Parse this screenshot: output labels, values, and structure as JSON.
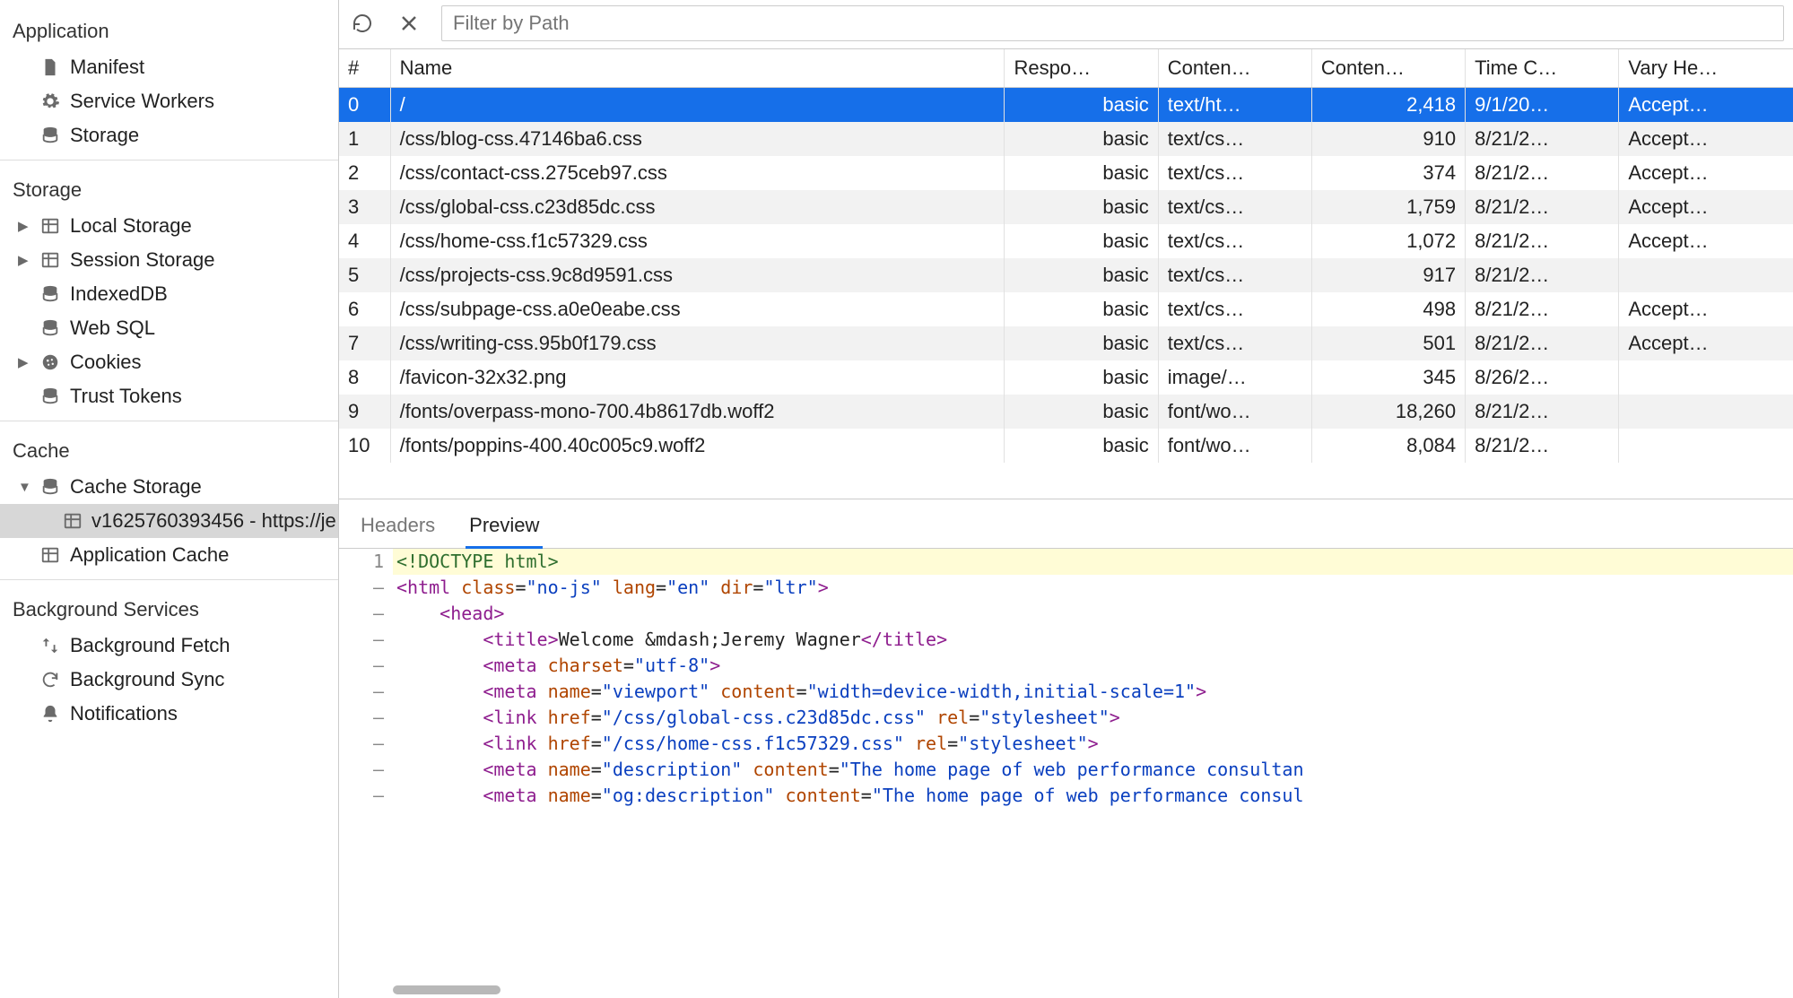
{
  "sidebar": {
    "sections": [
      {
        "title": "Application",
        "items": [
          {
            "name": "manifest",
            "label": "Manifest",
            "icon": "file-icon"
          },
          {
            "name": "service-workers",
            "label": "Service Workers",
            "icon": "gear-icon"
          },
          {
            "name": "storage",
            "label": "Storage",
            "icon": "database-icon"
          }
        ]
      },
      {
        "title": "Storage",
        "items": [
          {
            "name": "local-storage",
            "label": "Local Storage",
            "icon": "grid-icon",
            "expandable": true
          },
          {
            "name": "session-storage",
            "label": "Session Storage",
            "icon": "grid-icon",
            "expandable": true
          },
          {
            "name": "indexeddb",
            "label": "IndexedDB",
            "icon": "database-icon"
          },
          {
            "name": "web-sql",
            "label": "Web SQL",
            "icon": "database-icon"
          },
          {
            "name": "cookies",
            "label": "Cookies",
            "icon": "cookie-icon",
            "expandable": true
          },
          {
            "name": "trust-tokens",
            "label": "Trust Tokens",
            "icon": "database-icon"
          }
        ]
      },
      {
        "title": "Cache",
        "items": [
          {
            "name": "cache-storage",
            "label": "Cache Storage",
            "icon": "database-icon",
            "expandable": true,
            "expanded": true,
            "children": [
              {
                "name": "cache-entry",
                "label": "v1625760393456 - https://je",
                "icon": "grid-icon",
                "selected": true
              }
            ]
          },
          {
            "name": "application-cache",
            "label": "Application Cache",
            "icon": "grid-icon"
          }
        ]
      },
      {
        "title": "Background Services",
        "items": [
          {
            "name": "bg-fetch",
            "label": "Background Fetch",
            "icon": "swap-icon"
          },
          {
            "name": "bg-sync",
            "label": "Background Sync",
            "icon": "sync-icon"
          },
          {
            "name": "notifications",
            "label": "Notifications",
            "icon": "bell-icon"
          }
        ]
      }
    ]
  },
  "toolbar": {
    "filter_placeholder": "Filter by Path"
  },
  "table": {
    "headers": [
      "#",
      "Name",
      "Respo…",
      "Conten…",
      "Conten…",
      "Time C…",
      "Vary He…"
    ],
    "rows": [
      {
        "idx": "0",
        "name": "/",
        "resp": "basic",
        "ctype": "text/ht…",
        "clen": "2,418",
        "time": "9/1/20…",
        "vary": "Accept…",
        "selected": true
      },
      {
        "idx": "1",
        "name": "/css/blog-css.47146ba6.css",
        "resp": "basic",
        "ctype": "text/cs…",
        "clen": "910",
        "time": "8/21/2…",
        "vary": "Accept…"
      },
      {
        "idx": "2",
        "name": "/css/contact-css.275ceb97.css",
        "resp": "basic",
        "ctype": "text/cs…",
        "clen": "374",
        "time": "8/21/2…",
        "vary": "Accept…"
      },
      {
        "idx": "3",
        "name": "/css/global-css.c23d85dc.css",
        "resp": "basic",
        "ctype": "text/cs…",
        "clen": "1,759",
        "time": "8/21/2…",
        "vary": "Accept…"
      },
      {
        "idx": "4",
        "name": "/css/home-css.f1c57329.css",
        "resp": "basic",
        "ctype": "text/cs…",
        "clen": "1,072",
        "time": "8/21/2…",
        "vary": "Accept…"
      },
      {
        "idx": "5",
        "name": "/css/projects-css.9c8d9591.css",
        "resp": "basic",
        "ctype": "text/cs…",
        "clen": "917",
        "time": "8/21/2…",
        "vary": ""
      },
      {
        "idx": "6",
        "name": "/css/subpage-css.a0e0eabe.css",
        "resp": "basic",
        "ctype": "text/cs…",
        "clen": "498",
        "time": "8/21/2…",
        "vary": "Accept…"
      },
      {
        "idx": "7",
        "name": "/css/writing-css.95b0f179.css",
        "resp": "basic",
        "ctype": "text/cs…",
        "clen": "501",
        "time": "8/21/2…",
        "vary": "Accept…"
      },
      {
        "idx": "8",
        "name": "/favicon-32x32.png",
        "resp": "basic",
        "ctype": "image/…",
        "clen": "345",
        "time": "8/26/2…",
        "vary": ""
      },
      {
        "idx": "9",
        "name": "/fonts/overpass-mono-700.4b8617db.woff2",
        "resp": "basic",
        "ctype": "font/wo…",
        "clen": "18,260",
        "time": "8/21/2…",
        "vary": ""
      },
      {
        "idx": "10",
        "name": "/fonts/poppins-400.40c005c9.woff2",
        "resp": "basic",
        "ctype": "font/wo…",
        "clen": "8,084",
        "time": "8/21/2…",
        "vary": ""
      }
    ]
  },
  "tabs": {
    "headers_label": "Headers",
    "preview_label": "Preview"
  },
  "code": {
    "lines": [
      {
        "n": "1",
        "highlight": true,
        "tokens": [
          {
            "t": "<!DOCTYPE html>",
            "c": "doctype"
          }
        ]
      },
      {
        "n": "–",
        "tokens": [
          {
            "t": "<html ",
            "c": "tag"
          },
          {
            "t": "class",
            "c": "attr"
          },
          {
            "t": "=",
            "c": "text"
          },
          {
            "t": "\"no-js\"",
            "c": "str"
          },
          {
            "t": " ",
            "c": "text"
          },
          {
            "t": "lang",
            "c": "attr"
          },
          {
            "t": "=",
            "c": "text"
          },
          {
            "t": "\"en\"",
            "c": "str"
          },
          {
            "t": " ",
            "c": "text"
          },
          {
            "t": "dir",
            "c": "attr"
          },
          {
            "t": "=",
            "c": "text"
          },
          {
            "t": "\"ltr\"",
            "c": "str"
          },
          {
            "t": ">",
            "c": "tag"
          }
        ]
      },
      {
        "n": "–",
        "indent": 1,
        "tokens": [
          {
            "t": "<head>",
            "c": "tag"
          }
        ]
      },
      {
        "n": "–",
        "indent": 2,
        "tokens": [
          {
            "t": "<title>",
            "c": "tag"
          },
          {
            "t": "Welcome &mdash;Jeremy Wagner",
            "c": "text"
          },
          {
            "t": "</title>",
            "c": "tag"
          }
        ]
      },
      {
        "n": "–",
        "indent": 2,
        "tokens": [
          {
            "t": "<meta ",
            "c": "tag"
          },
          {
            "t": "charset",
            "c": "attr"
          },
          {
            "t": "=",
            "c": "text"
          },
          {
            "t": "\"utf-8\"",
            "c": "str"
          },
          {
            "t": ">",
            "c": "tag"
          }
        ]
      },
      {
        "n": "–",
        "indent": 2,
        "tokens": [
          {
            "t": "<meta ",
            "c": "tag"
          },
          {
            "t": "name",
            "c": "attr"
          },
          {
            "t": "=",
            "c": "text"
          },
          {
            "t": "\"viewport\"",
            "c": "str"
          },
          {
            "t": " ",
            "c": "text"
          },
          {
            "t": "content",
            "c": "attr"
          },
          {
            "t": "=",
            "c": "text"
          },
          {
            "t": "\"width=device-width,initial-scale=1\"",
            "c": "str"
          },
          {
            "t": ">",
            "c": "tag"
          }
        ]
      },
      {
        "n": "–",
        "indent": 2,
        "tokens": [
          {
            "t": "<link ",
            "c": "tag"
          },
          {
            "t": "href",
            "c": "attr"
          },
          {
            "t": "=",
            "c": "text"
          },
          {
            "t": "\"/css/global-css.c23d85dc.css\"",
            "c": "str"
          },
          {
            "t": " ",
            "c": "text"
          },
          {
            "t": "rel",
            "c": "attr"
          },
          {
            "t": "=",
            "c": "text"
          },
          {
            "t": "\"stylesheet\"",
            "c": "str"
          },
          {
            "t": ">",
            "c": "tag"
          }
        ]
      },
      {
        "n": "–",
        "indent": 2,
        "tokens": [
          {
            "t": "<link ",
            "c": "tag"
          },
          {
            "t": "href",
            "c": "attr"
          },
          {
            "t": "=",
            "c": "text"
          },
          {
            "t": "\"/css/home-css.f1c57329.css\"",
            "c": "str"
          },
          {
            "t": " ",
            "c": "text"
          },
          {
            "t": "rel",
            "c": "attr"
          },
          {
            "t": "=",
            "c": "text"
          },
          {
            "t": "\"stylesheet\"",
            "c": "str"
          },
          {
            "t": ">",
            "c": "tag"
          }
        ]
      },
      {
        "n": "–",
        "indent": 2,
        "tokens": [
          {
            "t": "<meta ",
            "c": "tag"
          },
          {
            "t": "name",
            "c": "attr"
          },
          {
            "t": "=",
            "c": "text"
          },
          {
            "t": "\"description\"",
            "c": "str"
          },
          {
            "t": " ",
            "c": "text"
          },
          {
            "t": "content",
            "c": "attr"
          },
          {
            "t": "=",
            "c": "text"
          },
          {
            "t": "\"The home page of web performance consultan",
            "c": "str"
          }
        ]
      },
      {
        "n": "–",
        "indent": 2,
        "tokens": [
          {
            "t": "<meta ",
            "c": "tag"
          },
          {
            "t": "name",
            "c": "attr"
          },
          {
            "t": "=",
            "c": "text"
          },
          {
            "t": "\"og:description\"",
            "c": "str"
          },
          {
            "t": " ",
            "c": "text"
          },
          {
            "t": "content",
            "c": "attr"
          },
          {
            "t": "=",
            "c": "text"
          },
          {
            "t": "\"The home page of web performance consul",
            "c": "str"
          }
        ]
      }
    ]
  }
}
